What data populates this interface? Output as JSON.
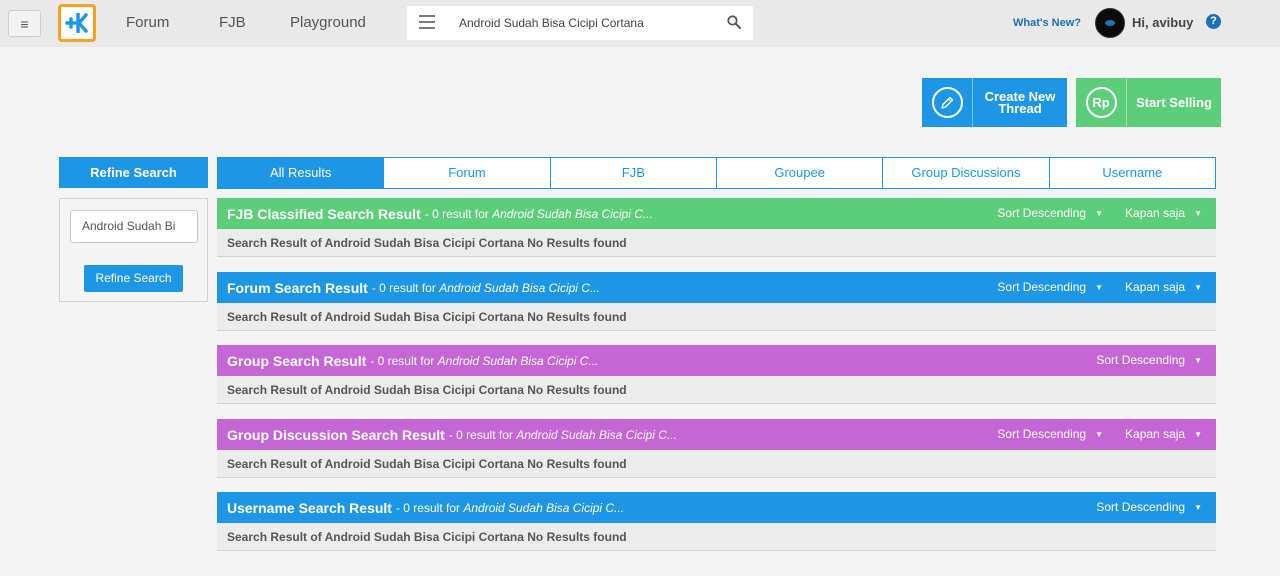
{
  "topbar": {
    "nav": [
      "Forum",
      "FJB",
      "Playground"
    ],
    "search_value": "Android Sudah Bisa Cicipi Cortana",
    "whats_new": "What's New?",
    "greeting": "Hi, avibuy",
    "help": "?"
  },
  "actions": {
    "create_line1": "Create New",
    "create_line2": "Thread",
    "sell_icon": "Rp",
    "sell": "Start Selling"
  },
  "refine": {
    "header": "Refine Search",
    "input_value": "Android Sudah Bi",
    "button": "Refine Search"
  },
  "tabs": [
    "All Results",
    "Forum",
    "FJB",
    "Groupee",
    "Group Discussions",
    "Username"
  ],
  "active_tab": "All Results",
  "sections": [
    {
      "title": "FJB Classified Search Result",
      "meta": "- 0 result for",
      "query": "Android Sudah Bisa Cicipi C...",
      "sort": "Sort Descending",
      "time": "Kapan saja",
      "body": "Search Result of Android Sudah Bisa Cicipi Cortana No Results found"
    },
    {
      "title": "Forum Search Result",
      "meta": "- 0 result for",
      "query": "Android Sudah Bisa Cicipi C...",
      "sort": "Sort Descending",
      "time": "Kapan saja",
      "body": "Search Result of Android Sudah Bisa Cicipi Cortana No Results found"
    },
    {
      "title": "Group Search Result",
      "meta": "- 0 result for",
      "query": "Android Sudah Bisa Cicipi C...",
      "sort": "Sort Descending",
      "body": "Search Result of Android Sudah Bisa Cicipi Cortana No Results found"
    },
    {
      "title": "Group Discussion Search Result",
      "meta": "- 0 result for",
      "query": "Android Sudah Bisa Cicipi C...",
      "sort": "Sort Descending",
      "time": "Kapan saja",
      "body": "Search Result of Android Sudah Bisa Cicipi Cortana No Results found"
    },
    {
      "title": "Username Search Result",
      "meta": "- 0 result for",
      "query": "Android Sudah Bisa Cicipi C...",
      "sort": "Sort Descending",
      "body": "Search Result of Android Sudah Bisa Cicipi Cortana No Results found"
    }
  ],
  "colors": {
    "blue": "#1e96e6",
    "green": "#5ccd79",
    "purple": "#c566d6",
    "logo_orange": "#f8a11e"
  },
  "icons": [
    "hamburger-icon",
    "kaskus-logo",
    "menu-icon",
    "search-icon",
    "pencil-icon",
    "rupiah-icon",
    "help-icon",
    "caret-down-icon"
  ]
}
